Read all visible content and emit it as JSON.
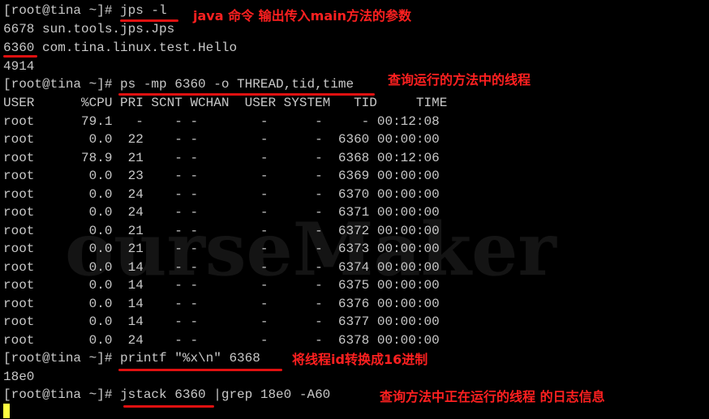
{
  "terminal": {
    "lines": [
      "[root@tina ~]# jps -l",
      "6678 sun.tools.jps.Jps",
      "6360 com.tina.linux.test.Hello",
      "4914",
      "[root@tina ~]# ps -mp 6360 -o THREAD,tid,time",
      "[root@tina ~]# printf \"%x\\n\" 6368",
      "18e0",
      "[root@tina ~]# jstack 6360 |grep 18e0 -A60"
    ],
    "table_header": "USER      %CPU PRI SCNT WCHAN  USER SYSTEM   TID     TIME",
    "table_rows": [
      "root      79.1   -    - -        -      -     - 00:12:08",
      "root       0.0  22    - -        -      -  6360 00:00:00",
      "root      78.9  21    - -        -      -  6368 00:12:06",
      "root       0.0  23    - -        -      -  6369 00:00:00",
      "root       0.0  24    - -        -      -  6370 00:00:00",
      "root       0.0  24    - -        -      -  6371 00:00:00",
      "root       0.0  21    - -        -      -  6372 00:00:00",
      "root       0.0  21    - -        -      -  6373 00:00:00",
      "root       0.0  14    - -        -      -  6374 00:00:00",
      "root       0.0  14    - -        -      -  6375 00:00:00",
      "root       0.0  14    - -        -      -  6376 00:00:00",
      "root       0.0  14    - -        -      -  6377 00:00:00",
      "root       0.0  24    - -        -      -  6378 00:00:00"
    ]
  },
  "annotations": {
    "jps": "java 命令 输出传入main方法的参数",
    "ps": "查询运行的方法中的线程",
    "printf": "将线程id转换成16进制",
    "jstack": "查询方法中正在运行的线程 的日志信息"
  },
  "watermark": "ourseMaker",
  "colors": {
    "background": "#000000",
    "text": "#c8c8c8",
    "annotation": "#ff2020",
    "cursor": "#ffff40"
  }
}
